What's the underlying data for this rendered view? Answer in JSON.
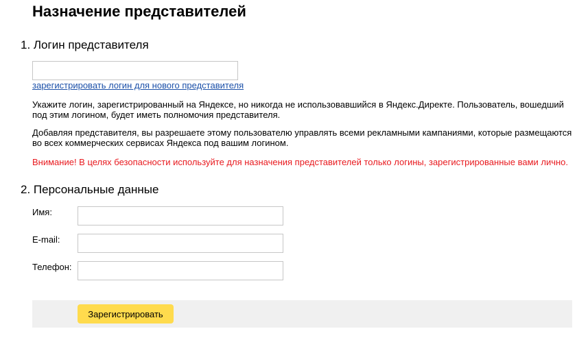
{
  "page": {
    "title": "Назначение представителей"
  },
  "section_login": {
    "heading": "1. Логин представителя",
    "login_value": "",
    "register_link": "зарегистрировать логин для нового представителя",
    "info_1": "Укажите логин, зарегистрированный на Яндексе, но никогда не использовавшийся в Яндекс.Директе. Пользователь, вошедший под этим логином, будет иметь полномочия представителя.",
    "info_2": "Добавляя представителя, вы разрешаете этому пользователю управлять всеми рекламными кампаниями, которые размещаются во всех коммерческих сервисах Яндекса под вашим логином.",
    "warning": "Внимание! В целях безопасности используйте для назначения представителей только логины, зарегистрированные вами лично."
  },
  "section_personal": {
    "heading": "2. Персональные данные",
    "name_label": "Имя:",
    "name_value": "",
    "email_label": "E-mail:",
    "email_value": "",
    "phone_label": "Телефон:",
    "phone_value": ""
  },
  "actions": {
    "submit_label": "Зарегистрировать"
  },
  "colors": {
    "link": "#1a4fa8",
    "warning": "#e8191e",
    "button": "#ffdb4d",
    "footer_bg": "#f0f0f0"
  }
}
